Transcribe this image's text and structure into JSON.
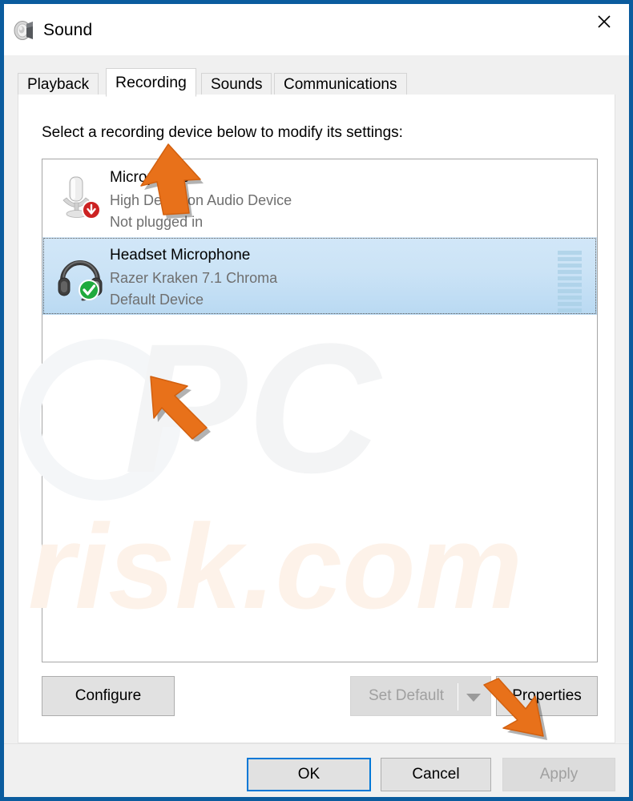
{
  "window": {
    "title": "Sound",
    "icon": "speaker-icon",
    "close_label": "✕",
    "border_color": "#0b5c9e"
  },
  "tabs": [
    {
      "label": "Playback",
      "active": false
    },
    {
      "label": "Recording",
      "active": true
    },
    {
      "label": "Sounds",
      "active": false
    },
    {
      "label": "Communications",
      "active": false
    }
  ],
  "panel": {
    "instruction": "Select a recording device below to modify its settings:"
  },
  "devices": [
    {
      "name": "Microphone",
      "description": "High Definition Audio Device",
      "status": "Not plugged in",
      "icon": "microphone-icon",
      "badge": "red-down-arrow-badge",
      "selected": false,
      "meter_segments": 0
    },
    {
      "name": "Headset Microphone",
      "description": "Razer Kraken 7.1 Chroma",
      "status": "Default Device",
      "icon": "headset-icon",
      "badge": "green-check-badge",
      "selected": true,
      "meter_segments": 10
    }
  ],
  "buttons": {
    "configure": "Configure",
    "set_default": "Set Default",
    "set_default_disabled": true,
    "set_default_dropdown": "chevron-down-icon",
    "properties": "Properties"
  },
  "footer": {
    "ok": "OK",
    "ok_focused": true,
    "cancel": "Cancel",
    "apply": "Apply",
    "apply_disabled": true
  },
  "watermark": {
    "text_primary": "PC",
    "text_secondary": "risk.com"
  },
  "annotations": [
    {
      "name": "arrow-pointing-recording-tab",
      "direction": "up"
    },
    {
      "name": "arrow-pointing-headset-device",
      "direction": "up-left"
    },
    {
      "name": "arrow-pointing-properties-button",
      "direction": "down-right"
    }
  ],
  "colors": {
    "accent": "#0078d7",
    "titlebar_border": "#0b5c9e",
    "selection": "#cbe3f6",
    "annotation_orange": "#e8711a",
    "muted_text": "#6f6f6f",
    "disabled_text": "#a0a0a0"
  }
}
